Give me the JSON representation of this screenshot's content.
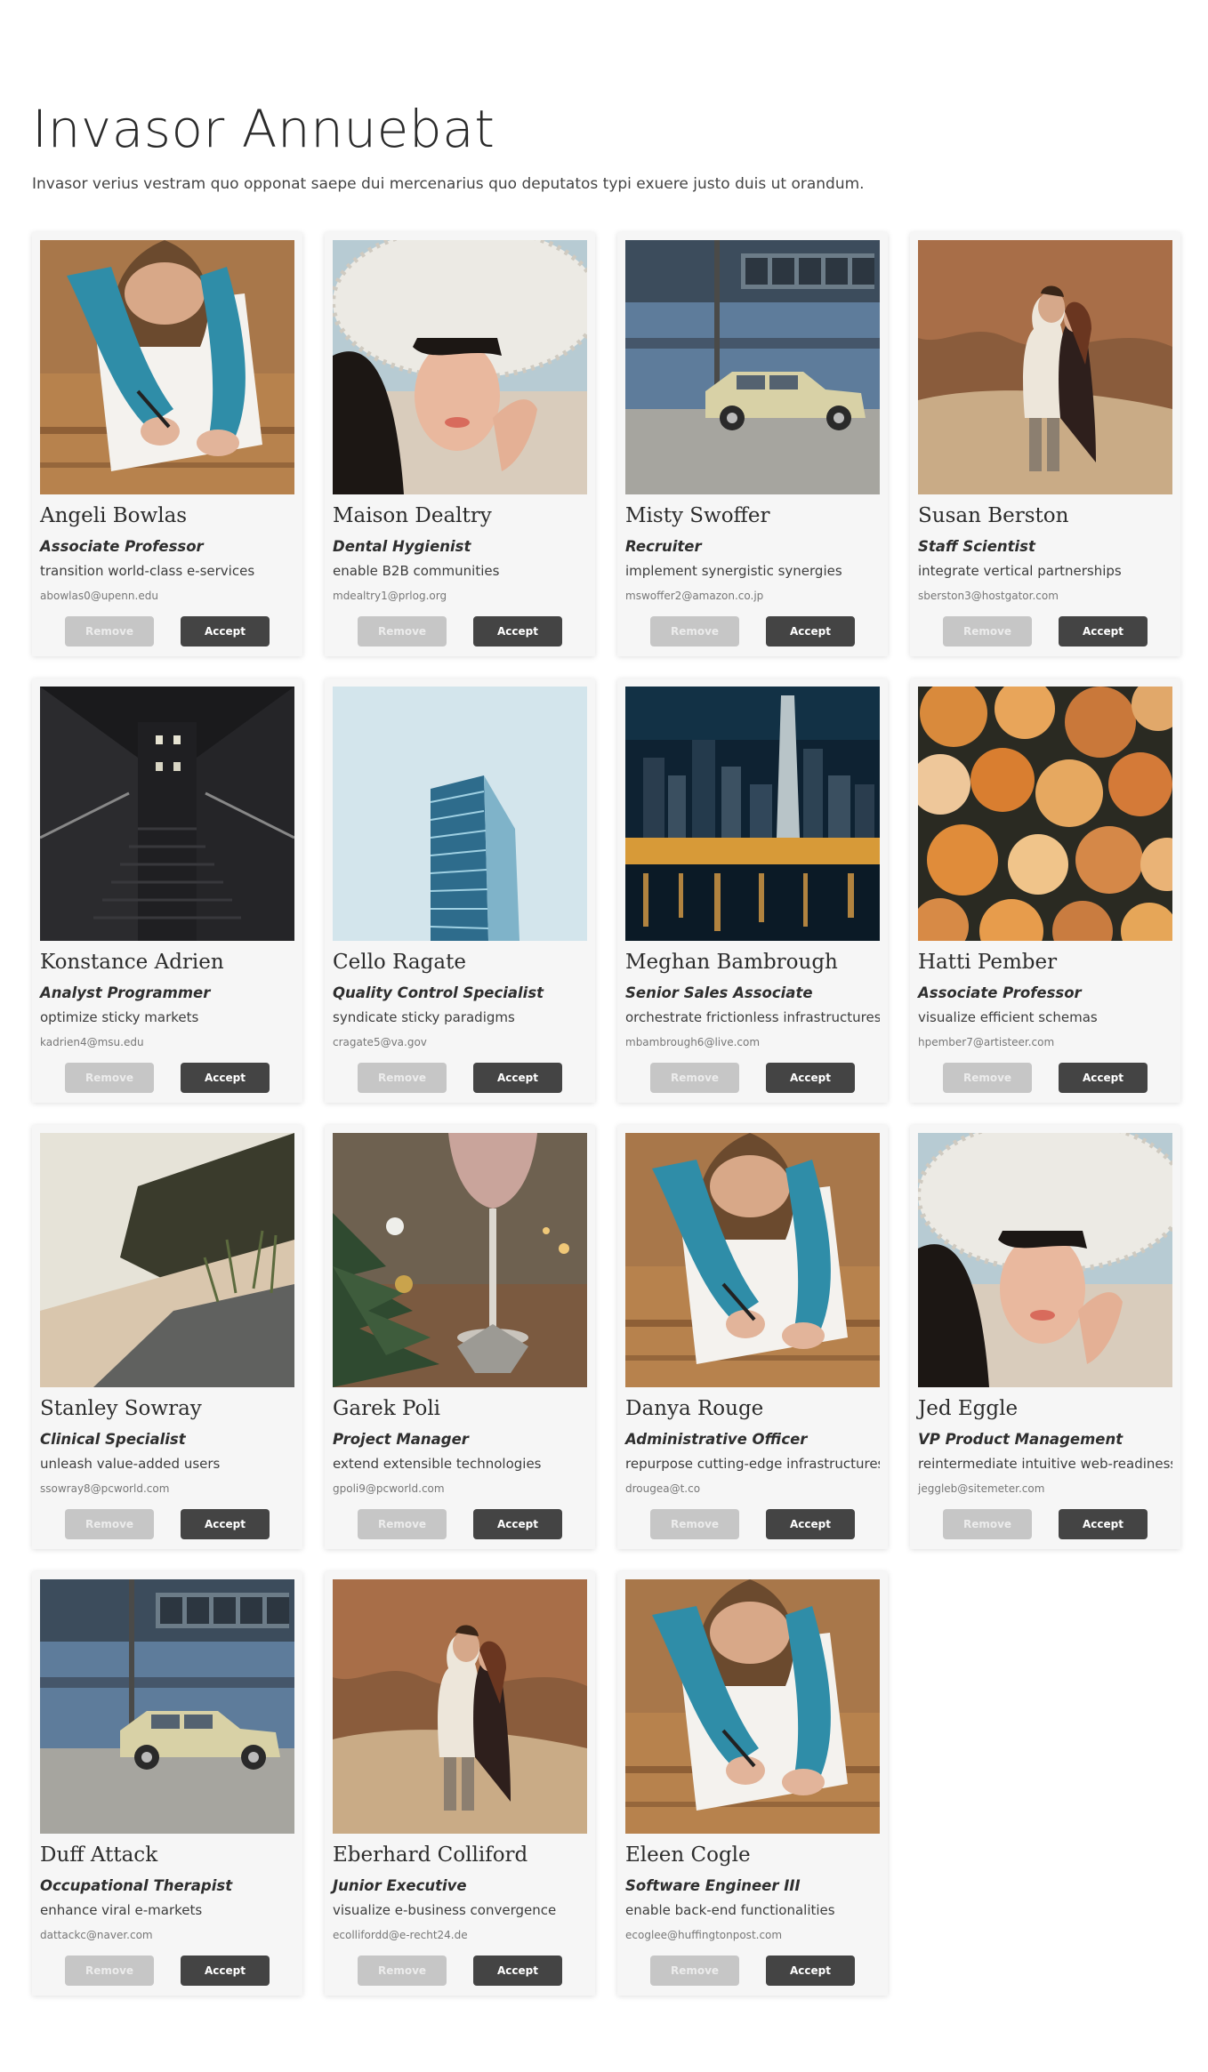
{
  "page": {
    "title": "Invasor Annuebat",
    "intro": "Invasor verius vestram quo opponat saepe dui mercenarius quo deputatos typi exuere justo duis ut orandum."
  },
  "buttons": {
    "remove_label": "Remove",
    "accept_label": "Accept"
  },
  "colors": {
    "card_background": "#f6f6f6",
    "accept_button": "#444444",
    "remove_button": "#c6c6c6"
  },
  "cards": [
    {
      "name": "Angeli Bowlas",
      "role": "Associate Professor",
      "tagline": "transition world-class e-services",
      "email": "abowlas0@upenn.edu",
      "photo": "girl-drawing-photo"
    },
    {
      "name": "Maison Dealtry",
      "role": "Dental Hygienist",
      "tagline": "enable B2B communities",
      "email": "mdealtry1@prlog.org",
      "photo": "woman-sunhat-photo"
    },
    {
      "name": "Misty Swoffer",
      "role": "Recruiter",
      "tagline": "implement synergistic synergies",
      "email": "mswoffer2@amazon.co.jp",
      "photo": "vintage-car-photo"
    },
    {
      "name": "Susan Berston",
      "role": "Staff Scientist",
      "tagline": "integrate vertical partnerships",
      "email": "sberston3@hostgator.com",
      "photo": "couple-canyon-photo"
    },
    {
      "name": "Konstance Adrien",
      "role": "Analyst Programmer",
      "tagline": "optimize sticky markets",
      "email": "kadrien4@msu.edu",
      "photo": "dark-stairway-photo"
    },
    {
      "name": "Cello Ragate",
      "role": "Quality Control Specialist",
      "tagline": "syndicate sticky paradigms",
      "email": "cragate5@va.gov",
      "photo": "glass-tower-photo"
    },
    {
      "name": "Meghan Bambrough",
      "role": "Senior Sales Associate",
      "tagline": "orchestrate frictionless infrastructures",
      "email": "mbambrough6@live.com",
      "photo": "city-night-photo"
    },
    {
      "name": "Hatti Pember",
      "role": "Associate Professor",
      "tagline": "visualize efficient schemas",
      "email": "hpember7@artisteer.com",
      "photo": "pumpkins-photo"
    },
    {
      "name": "Stanley Sowray",
      "role": "Clinical Specialist",
      "tagline": "unleash value-added users",
      "email": "ssowray8@pcworld.com",
      "photo": "beach-cliff-photo"
    },
    {
      "name": "Garek Poli",
      "role": "Project Manager",
      "tagline": "extend extensible technologies",
      "email": "gpoli9@pcworld.com",
      "photo": "wine-glass-photo"
    },
    {
      "name": "Danya Rouge",
      "role": "Administrative Officer",
      "tagline": "repurpose cutting-edge infrastructures",
      "email": "drougea@t.co",
      "photo": "girl-drawing-photo"
    },
    {
      "name": "Jed Eggle",
      "role": "VP Product Management",
      "tagline": "reintermediate intuitive web-readiness",
      "email": "jeggleb@sitemeter.com",
      "photo": "woman-sunhat-photo"
    },
    {
      "name": "Duff Attack",
      "role": "Occupational Therapist",
      "tagline": "enhance viral e-markets",
      "email": "dattackc@naver.com",
      "photo": "vintage-car-photo"
    },
    {
      "name": "Eberhard Colliford",
      "role": "Junior Executive",
      "tagline": "visualize e-business convergence",
      "email": "ecollifordd@e-recht24.de",
      "photo": "couple-canyon-photo"
    },
    {
      "name": "Eleen Cogle",
      "role": "Software Engineer III",
      "tagline": "enable back-end functionalities",
      "email": "ecoglee@huffingtonpost.com",
      "photo": "girl-drawing-photo"
    }
  ]
}
